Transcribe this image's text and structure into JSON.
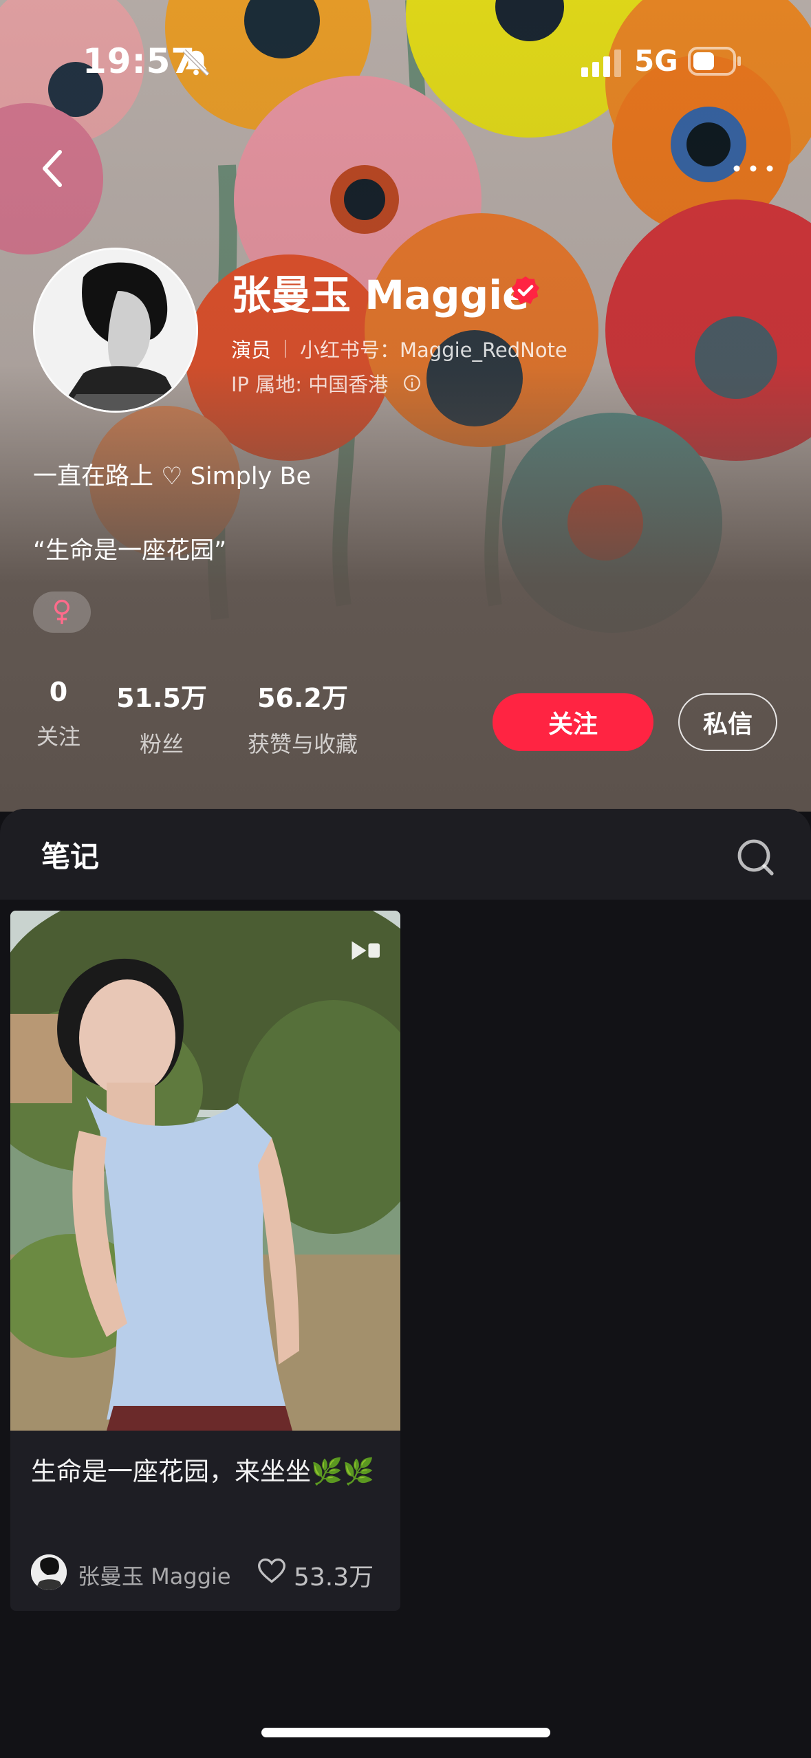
{
  "status_bar": {
    "time": "19:57",
    "network": "5G",
    "icons": [
      "bell-muted-icon",
      "cellular-signal-icon",
      "battery-icon"
    ]
  },
  "nav": {
    "back_icon": "chevron-left-icon",
    "more_icon": "more-dots-icon"
  },
  "profile": {
    "name": "张曼玉 Maggie",
    "verified_icon": "verified-check-icon",
    "role": "演员",
    "redbook_id": "小红书号：Maggie_RedNote",
    "ip_location": "IP 属地: 中国香港",
    "bio_line1": "一直在路上 ♡ Simply Be",
    "bio_line2": "“生命是一座花园”",
    "gender_icon": "female-symbol-icon",
    "stats": {
      "following_value": "0",
      "following_label": "关注",
      "fans_value": "51.5万",
      "fans_label": "粉丝",
      "likes_value": "56.2万",
      "likes_label": "获赞与收藏"
    },
    "follow_button": "关注",
    "message_button": "私信"
  },
  "notes": {
    "tab_label": "笔记",
    "search_icon": "search-icon",
    "items": [
      {
        "title": "生命是一座花园，来坐坐🌿🌿",
        "author": "张曼玉 Maggie",
        "likes": "53.3万",
        "type_icon": "video-icon"
      }
    ]
  },
  "colors": {
    "accent": "#ff2442",
    "panel_bg": "#121216",
    "tabbar_bg": "#1d1d22",
    "card_bg": "#1e1e24"
  }
}
